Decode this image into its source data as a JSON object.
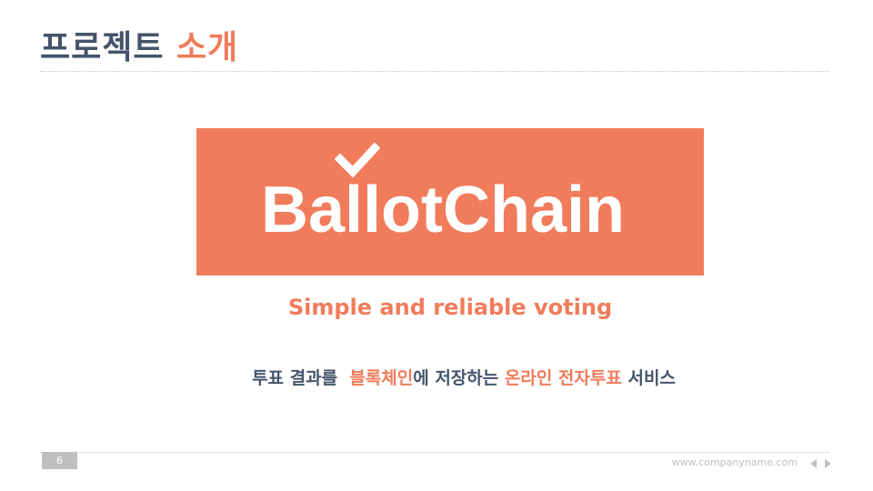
{
  "slide": {
    "title_main": "프로젝트",
    "title_accent": "소개",
    "logo_text": "BallotChain",
    "tagline": "Simple and reliable voting",
    "description": {
      "part1": "투표 결과를  ",
      "highlight1": "블록체인",
      "part2": "에 저장하는 ",
      "highlight2": "온라인 전자투표",
      "part3": " 서비스"
    }
  },
  "footer": {
    "page_number": "6",
    "website": "www.companyname.com"
  },
  "icons": {
    "logo": "checkmark-icon",
    "prev": "triangle-left-icon",
    "next": "triangle-right-icon"
  },
  "colors": {
    "accent": "#f07c5c",
    "dark_text": "#44546a",
    "muted": "#bfbfbf"
  }
}
